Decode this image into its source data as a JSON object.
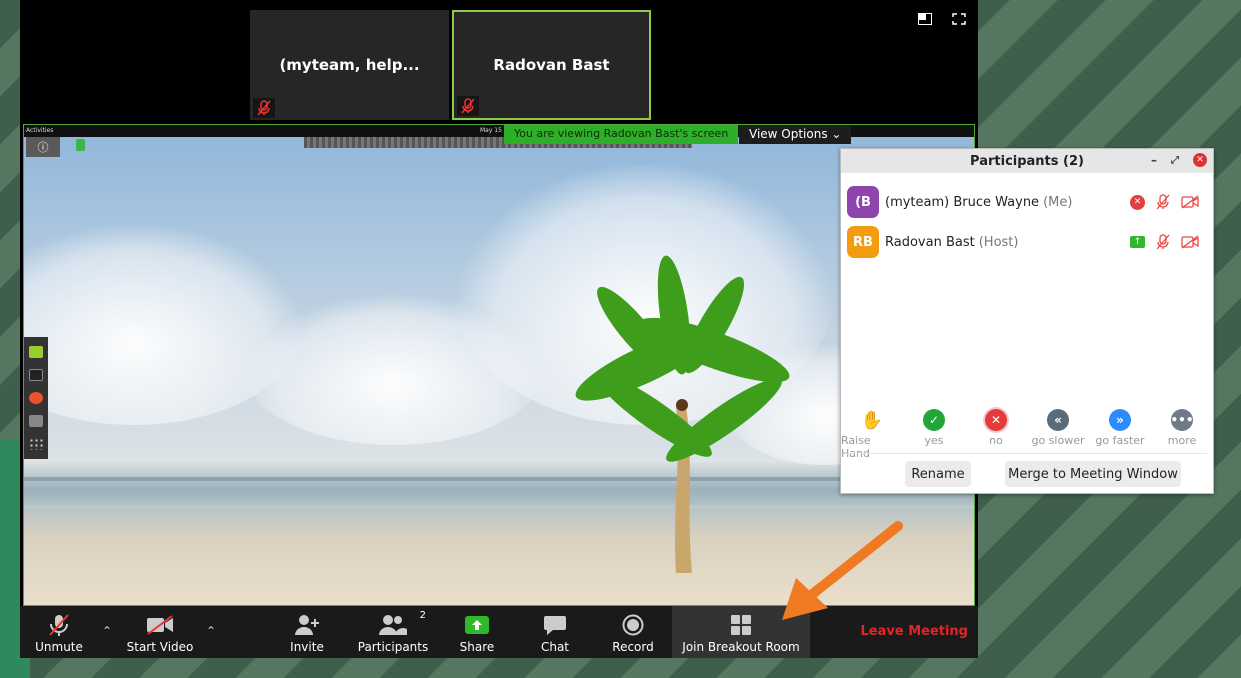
{
  "thumbnails": [
    {
      "name": "(myteam, help..."
    },
    {
      "name": "Radovan Bast"
    }
  ],
  "screen": {
    "activities": "Activities",
    "date": "May 15",
    "banner": "You are viewing Radovan Bast's screen",
    "view_options": "View Options",
    "info_icon": "info-icon"
  },
  "toolbar": {
    "unmute": "Unmute",
    "start_video": "Start Video",
    "invite": "Invite",
    "participants": "Participants",
    "participants_count": "2",
    "share": "Share",
    "chat": "Chat",
    "record": "Record",
    "breakout": "Join Breakout Room",
    "leave": "Leave Meeting"
  },
  "participants_panel": {
    "title": "Participants (2)",
    "participants": [
      {
        "initials": "(B",
        "name": "(myteam) Bruce Wayne",
        "role": "(Me)",
        "color": "#8e44ad"
      },
      {
        "initials": "RB",
        "name": "Radovan Bast",
        "role": "(Host)",
        "color": "#f39c12"
      }
    ],
    "reactions": [
      {
        "label": "Raise Hand",
        "icon": "raise-hand-icon",
        "color": "#2e8bff"
      },
      {
        "label": "yes",
        "icon": "check-icon",
        "color": "#22a63a"
      },
      {
        "label": "no",
        "icon": "x-icon",
        "color": "#e53a3a"
      },
      {
        "label": "go slower",
        "icon": "rewind-icon",
        "color": "#5a6b7c"
      },
      {
        "label": "go faster",
        "icon": "fast-forward-icon",
        "color": "#2e8bff"
      },
      {
        "label": "more",
        "icon": "more-icon",
        "color": "#6e7b86"
      }
    ],
    "rename": "Rename",
    "merge": "Merge to Meeting Window"
  },
  "colors": {
    "accent_green": "#2eaf2a",
    "leave_red": "#e02626",
    "arrow_orange": "#f07a21"
  }
}
